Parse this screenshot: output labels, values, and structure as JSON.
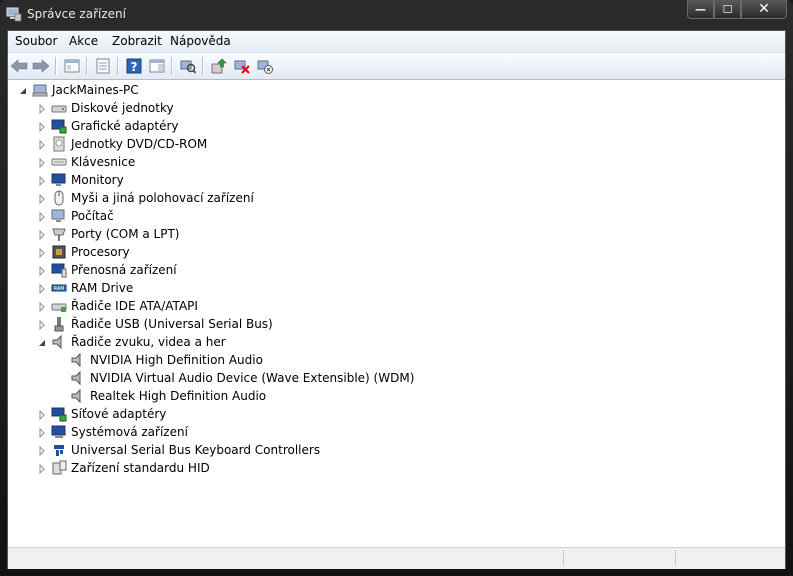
{
  "window": {
    "title": "Správce zařízení",
    "caption": {
      "minimize": "—",
      "maximize": "☐",
      "close": "✕"
    }
  },
  "menu": [
    "Soubor",
    "Akce",
    "Zobrazit",
    "Nápověda"
  ],
  "toolbar": {
    "buttons": [
      "back-icon",
      "forward-icon",
      "sep",
      "console-tree-icon",
      "sep",
      "properties-icon",
      "sep",
      "help-icon",
      "show-hide-action-pane-icon",
      "sep",
      "scan-hardware-changes-icon",
      "sep",
      "update-driver-icon",
      "uninstall-device-icon",
      "disable-device-icon"
    ]
  },
  "tree": {
    "root": "JackMaines-PC",
    "categories": [
      {
        "label": "Diskové jednotky",
        "icon": "disk-drive-icon"
      },
      {
        "label": "Grafické adaptéry",
        "icon": "display-adapter-icon"
      },
      {
        "label": "Jednotky DVD/CD-ROM",
        "icon": "dvd-drive-icon"
      },
      {
        "label": "Klávesnice",
        "icon": "keyboard-icon"
      },
      {
        "label": "Monitory",
        "icon": "monitor-icon"
      },
      {
        "label": "Myši a jiná polohovací zařízení",
        "icon": "mouse-icon"
      },
      {
        "label": "Počítač",
        "icon": "computer-icon"
      },
      {
        "label": "Porty (COM a LPT)",
        "icon": "port-icon"
      },
      {
        "label": "Procesory",
        "icon": "processor-icon"
      },
      {
        "label": "Přenosná zařízení",
        "icon": "portable-device-icon"
      },
      {
        "label": "RAM Drive",
        "icon": "ram-drive-icon"
      },
      {
        "label": "Řadiče IDE ATA/ATAPI",
        "icon": "ide-controller-icon"
      },
      {
        "label": "Řadiče USB (Universal Serial Bus)",
        "icon": "usb-controller-icon"
      },
      {
        "label": "Řadiče zvuku, videa a her",
        "icon": "sound-icon",
        "expanded": true,
        "children": [
          "NVIDIA High Definition Audio",
          "NVIDIA Virtual Audio Device (Wave Extensible) (WDM)",
          "Realtek High Definition Audio"
        ]
      },
      {
        "label": "Síťové adaptéry",
        "icon": "network-adapter-icon"
      },
      {
        "label": "Systémová zařízení",
        "icon": "system-device-icon"
      },
      {
        "label": "Universal Serial Bus Keyboard Controllers",
        "icon": "usb-keyboard-controller-icon"
      },
      {
        "label": "Zařízení standardu HID",
        "icon": "hid-device-icon"
      }
    ]
  }
}
